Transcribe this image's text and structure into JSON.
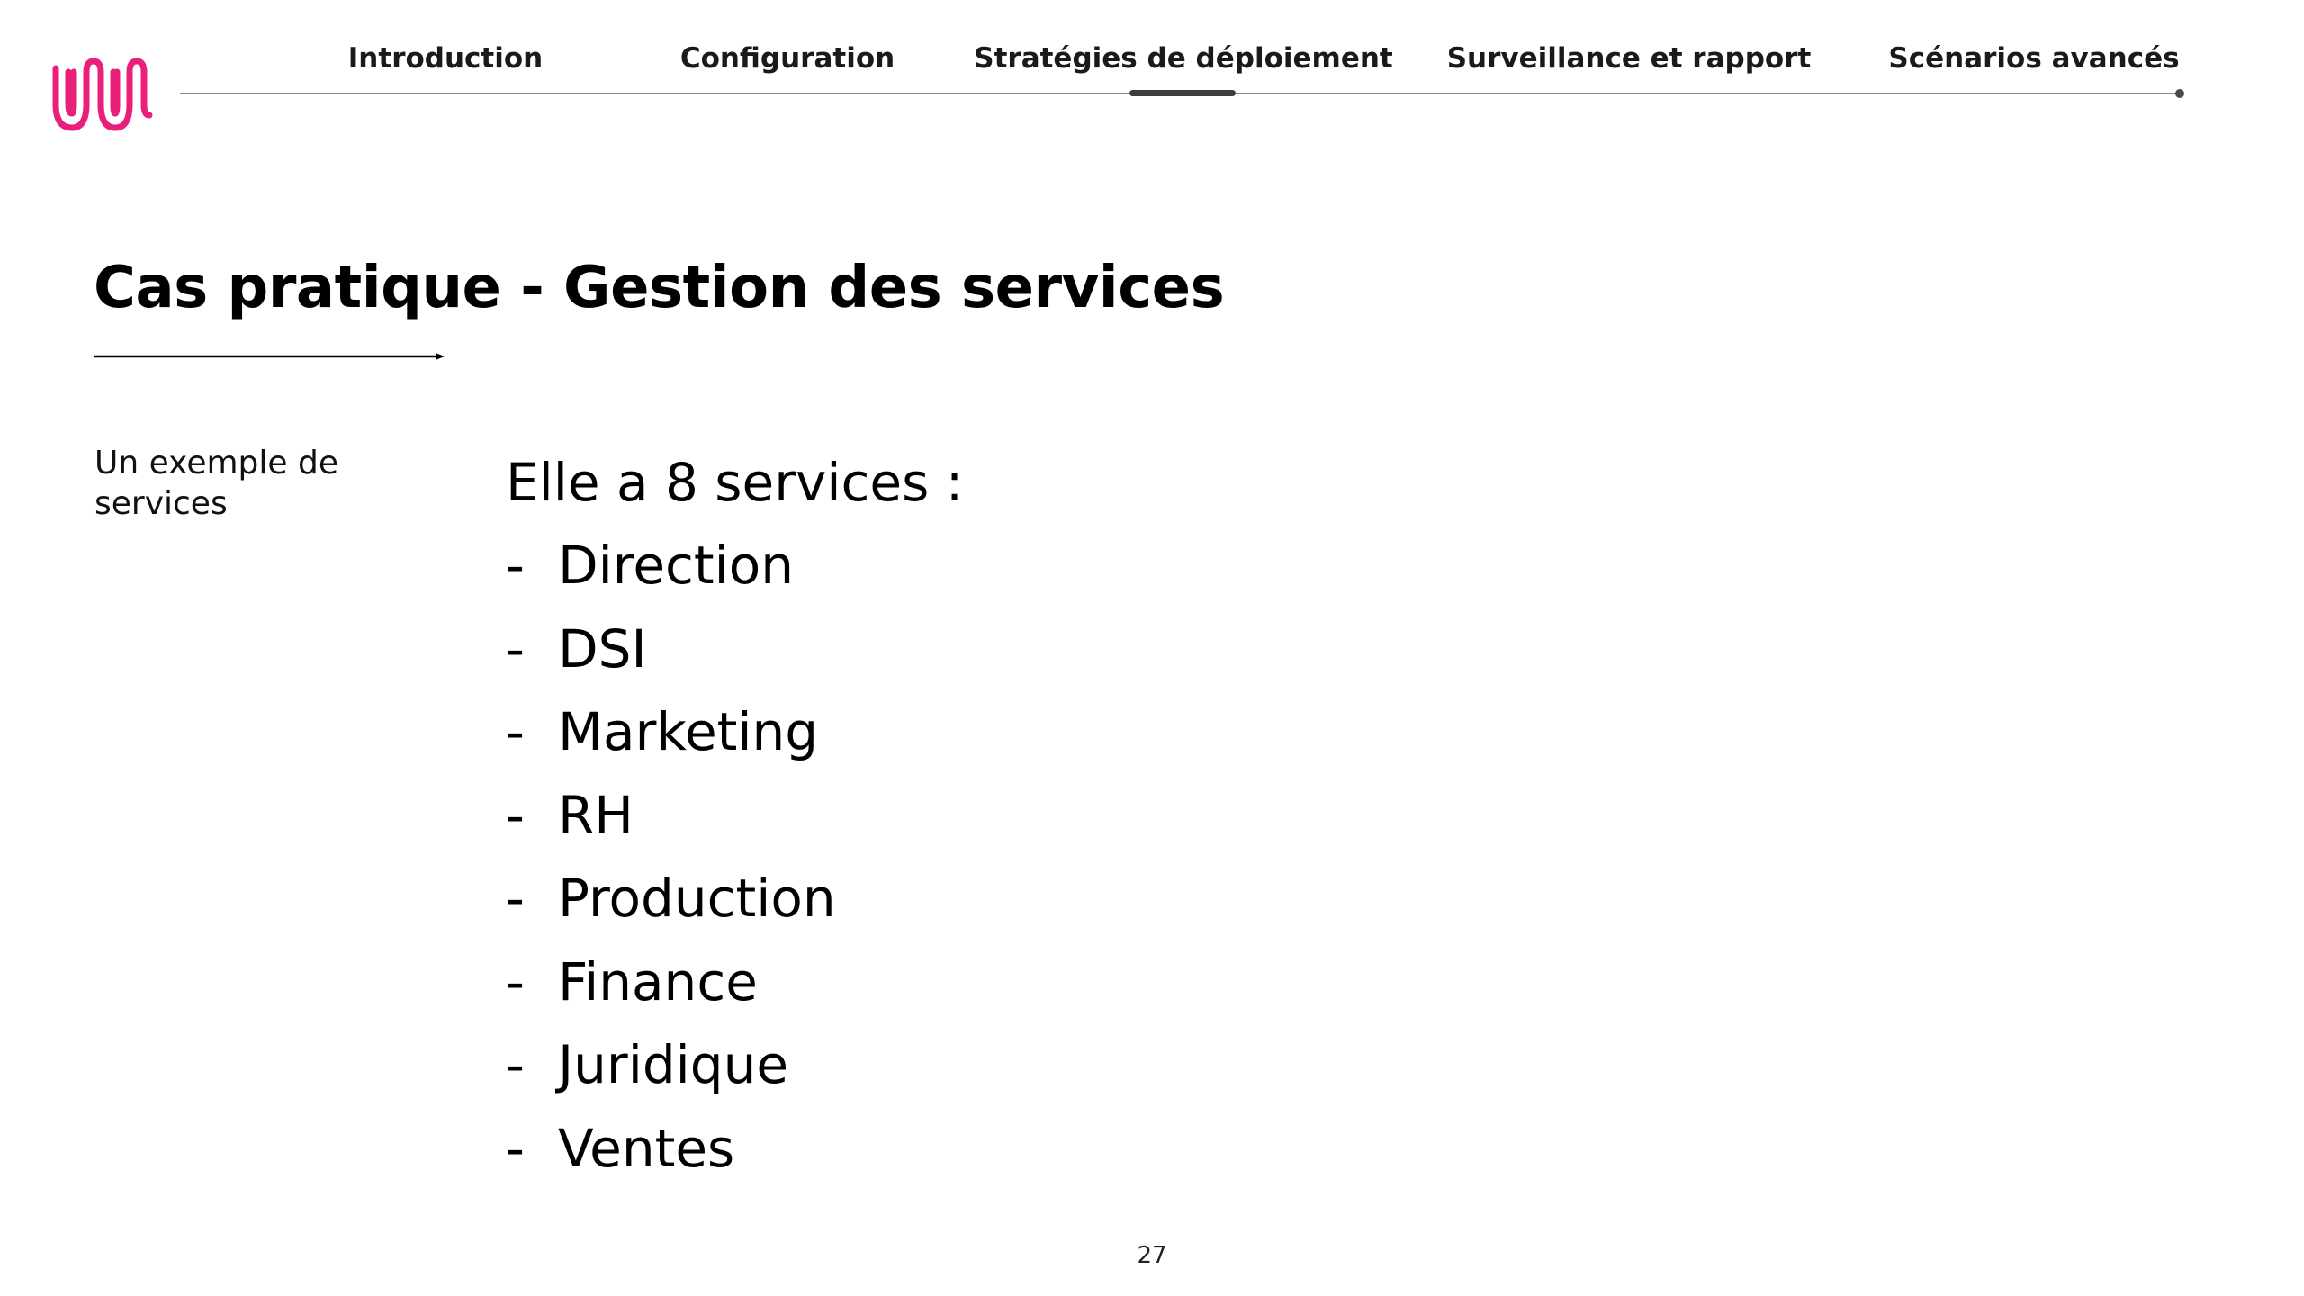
{
  "brand": {
    "logo_icon": "wavy-squiggle-logo-icon",
    "accent_color": "#E8207A"
  },
  "nav": {
    "tabs": [
      {
        "label": "Introduction",
        "active": false
      },
      {
        "label": "Configuration",
        "active": false
      },
      {
        "label": "Stratégies de déploiement",
        "active": true
      },
      {
        "label": "Surveillance et rapport",
        "active": false
      },
      {
        "label": "Scénarios avancés",
        "active": false
      }
    ],
    "line_color": "#8a8a8a",
    "indicator_color": "#3d3d3d"
  },
  "slide": {
    "title": "Cas pratique - Gestion des services",
    "side_caption": "Un exemple de services",
    "intro": "Elle a 8 services :",
    "bullet_marker": "-",
    "services": [
      "Direction",
      "DSI",
      "Marketing",
      "RH",
      "Production",
      "Finance",
      "Juridique",
      "Ventes"
    ],
    "page_number": "27"
  }
}
